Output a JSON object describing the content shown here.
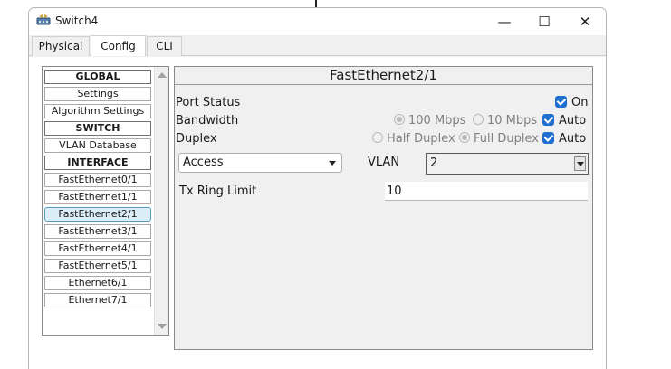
{
  "window": {
    "title": "Switch4",
    "controls": {
      "minimize": "—",
      "maximize": "☐",
      "close": "✕"
    }
  },
  "tabs": [
    {
      "label": "Physical"
    },
    {
      "label": "Config",
      "active": true
    },
    {
      "label": "CLI"
    }
  ],
  "nav": {
    "items": [
      {
        "label": "GLOBAL",
        "header": true
      },
      {
        "label": "Settings"
      },
      {
        "label": "Algorithm Settings"
      },
      {
        "label": "SWITCH",
        "header": true
      },
      {
        "label": "VLAN Database"
      },
      {
        "label": "INTERFACE",
        "header": true
      },
      {
        "label": "FastEthernet0/1"
      },
      {
        "label": "FastEthernet1/1"
      },
      {
        "label": "FastEthernet2/1",
        "selected": true
      },
      {
        "label": "FastEthernet3/1"
      },
      {
        "label": "FastEthernet4/1"
      },
      {
        "label": "FastEthernet5/1"
      },
      {
        "label": "Ethernet6/1"
      },
      {
        "label": "Ethernet7/1"
      }
    ]
  },
  "panel": {
    "title": "FastEthernet2/1",
    "port_status": {
      "label": "Port Status",
      "on_label": "On",
      "on_checked": true
    },
    "bandwidth": {
      "label": "Bandwidth",
      "opt_100": "100 Mbps",
      "opt_10": "10 Mbps",
      "auto_label": "Auto",
      "auto_checked": true
    },
    "duplex": {
      "label": "Duplex",
      "opt_half": "Half Duplex",
      "opt_full": "Full Duplex",
      "auto_label": "Auto",
      "auto_checked": true
    },
    "mode": {
      "selected": "Access"
    },
    "vlan": {
      "label": "VLAN",
      "value": "2"
    },
    "tx_ring": {
      "label": "Tx Ring Limit",
      "value": "10"
    }
  },
  "colors": {
    "checkbox": "#1e6fd0",
    "selected_item_bg": "#dbeef8",
    "selected_item_border": "#5a9bc4"
  }
}
